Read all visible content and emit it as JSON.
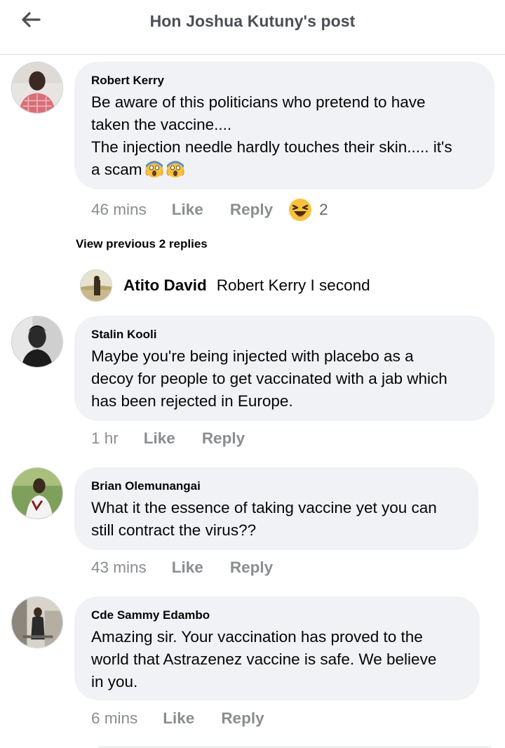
{
  "header": {
    "title": "Hon Joshua Kutuny's post",
    "back_icon": "back-arrow-icon"
  },
  "comments": [
    {
      "author": "Robert Kerry",
      "text_lines": [
        "Be aware of this politicians who pretend to have",
        "taken the vaccine....",
        "The injection needle hardly touches their skin..... it's",
        "a scam"
      ],
      "emoji": [
        "😱",
        "😱"
      ],
      "time": "46 mins",
      "like": "Like",
      "reply": "Reply",
      "reaction": {
        "icon": "haha-reaction-icon",
        "count": "2"
      }
    },
    {
      "author": "Stalin Kooli",
      "text_lines": [
        "Maybe you're being injected with placebo as a",
        "decoy for people to get vaccinated with a jab which",
        "has been rejected in Europe."
      ],
      "time": "1 hr",
      "like": "Like",
      "reply": "Reply"
    },
    {
      "author": "Brian Olemunangai",
      "text_lines": [
        "What it the essence of taking vaccine yet you can",
        "still contract the virus??"
      ],
      "time": "43 mins",
      "like": "Like",
      "reply": "Reply"
    },
    {
      "author": "Cde Sammy Edambo",
      "text_lines": [
        "Amazing sir. Your vaccination has proved to the",
        "world that Astrazenez vaccine is safe. We believe",
        "in you."
      ],
      "time": "6 mins",
      "like": "Like",
      "reply": "Reply"
    }
  ],
  "replies": {
    "view_previous": "View previous 2 replies",
    "latest": {
      "author": "Atito David",
      "text": "Robert Kerry I second"
    }
  },
  "colors": {
    "bubble": "#f0f2f5",
    "meta_text": "#8a8d91",
    "header_text": "#4b4f56"
  }
}
